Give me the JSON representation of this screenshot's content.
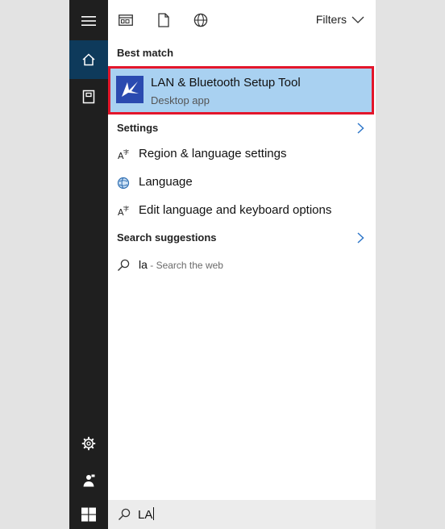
{
  "top_bar": {
    "filters_label": "Filters"
  },
  "sections": {
    "best_match": "Best match",
    "settings": "Settings",
    "search_suggestions": "Search suggestions"
  },
  "best_match": {
    "name": "LAN & Bluetooth Setup Tool",
    "type": "Desktop app"
  },
  "settings_items": [
    {
      "label": "Region & language settings",
      "icon": "region-icon"
    },
    {
      "label": "Language",
      "icon": "language-globe-icon"
    },
    {
      "label": "Edit language and keyboard options",
      "icon": "keyboard-language-icon"
    }
  ],
  "suggestion": {
    "query": "la",
    "hint": " - Search the web"
  },
  "search": {
    "value": "LA"
  },
  "colors": {
    "accent": "#0e3a5b",
    "highlight": "#a9d1f1",
    "selection_border": "#e3162b",
    "sidebar": "#1f1f1f"
  }
}
